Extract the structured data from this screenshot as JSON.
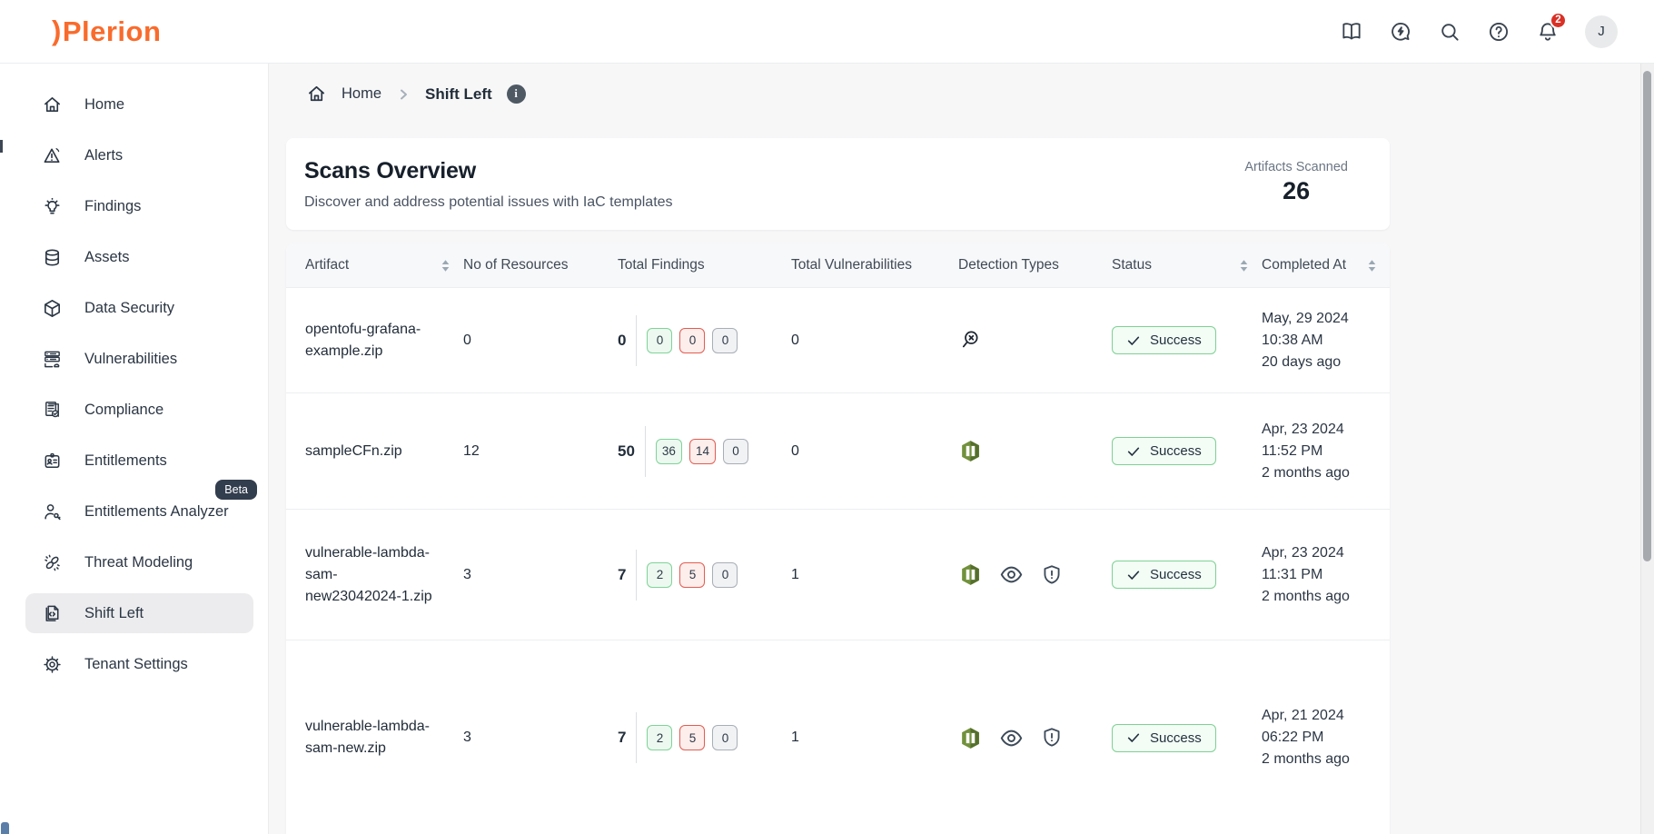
{
  "brand": {
    "logo_mark": ")",
    "logo_text": "Plerion"
  },
  "topbar": {
    "icons": [
      "docs-book-icon",
      "feedback-chat-icon",
      "search-icon",
      "help-icon",
      "notifications-bell-icon"
    ],
    "notification_count": "2",
    "avatar_initial": "J"
  },
  "sidebar": {
    "items": [
      {
        "label": "Home",
        "icon": "home-icon"
      },
      {
        "label": "Alerts",
        "icon": "alerts-icon"
      },
      {
        "label": "Findings",
        "icon": "findings-icon"
      },
      {
        "label": "Assets",
        "icon": "assets-icon"
      },
      {
        "label": "Data Security",
        "icon": "data-security-icon"
      },
      {
        "label": "Vulnerabilities",
        "icon": "vulnerabilities-icon"
      },
      {
        "label": "Compliance",
        "icon": "compliance-icon"
      },
      {
        "label": "Entitlements",
        "icon": "entitlements-icon"
      },
      {
        "label": "Entitlements Analyzer",
        "icon": "entitlements-analyzer-icon",
        "badge": "Beta"
      },
      {
        "label": "Threat Modeling",
        "icon": "threat-modeling-icon"
      },
      {
        "label": "Shift Left",
        "icon": "shift-left-icon",
        "active": true
      },
      {
        "label": "Tenant Settings",
        "icon": "tenant-settings-icon"
      }
    ]
  },
  "breadcrumb": {
    "items": [
      "Home",
      "Shift Left"
    ]
  },
  "overview": {
    "title": "Scans Overview",
    "subtitle": "Discover and address potential issues with IaC templates",
    "stat_label": "Artifacts Scanned",
    "stat_value": "26"
  },
  "table": {
    "columns": [
      {
        "label": "Artifact",
        "sortable": true
      },
      {
        "label": "No of Resources",
        "sortable": false
      },
      {
        "label": "Total Findings",
        "sortable": false
      },
      {
        "label": "Total Vulnerabilities",
        "sortable": false
      },
      {
        "label": "Detection Types",
        "sortable": false
      },
      {
        "label": "Status",
        "sortable": true
      },
      {
        "label": "Completed At",
        "sortable": true
      }
    ],
    "rows": [
      {
        "artifact": "opentofu-grafana-example.zip",
        "resources": "0",
        "findings_total": "0",
        "findings_badges": [
          "0",
          "0",
          "0"
        ],
        "vulnerabilities": "0",
        "detections": [
          "scan-no-detection-icon"
        ],
        "status": "Success",
        "completed_date": "May, 29 2024 10:38 AM",
        "completed_ago": "20 days ago"
      },
      {
        "artifact": "sampleCFn.zip",
        "resources": "12",
        "findings_total": "50",
        "findings_badges": [
          "36",
          "14",
          "0"
        ],
        "vulnerabilities": "0",
        "detections": [
          "cloudformation-icon"
        ],
        "status": "Success",
        "completed_date": "Apr, 23 2024 11:52 PM",
        "completed_ago": "2 months ago"
      },
      {
        "artifact": "vulnerable-lambda-sam-new23042024-1.zip",
        "resources": "3",
        "findings_total": "7",
        "findings_badges": [
          "2",
          "5",
          "0"
        ],
        "vulnerabilities": "1",
        "detections": [
          "cloudformation-icon",
          "eye-icon",
          "shield-icon"
        ],
        "status": "Success",
        "completed_date": "Apr, 23 2024 11:31 PM",
        "completed_ago": "2 months ago"
      },
      {
        "artifact": "vulnerable-lambda-sam-new.zip",
        "resources": "3",
        "findings_total": "7",
        "findings_badges": [
          "2",
          "5",
          "0"
        ],
        "vulnerabilities": "1",
        "detections": [
          "cloudformation-icon",
          "eye-icon",
          "shield-icon"
        ],
        "status": "Success",
        "completed_date": "Apr, 21 2024 06:22 PM",
        "completed_ago": "2 months ago"
      }
    ]
  },
  "colors": {
    "brand_orange": "#F96B2C",
    "notification_red": "#D93025",
    "success_border": "#7ED194",
    "success_bg": "#F3FCF5",
    "badge_green_border": "#7FD398",
    "badge_green_bg": "#EDF9F0",
    "badge_red_border": "#E25C50",
    "badge_red_bg": "#FDEEEC",
    "badge_gray_border": "#A8AEB6",
    "badge_gray_bg": "#F1F2F4",
    "cloudformation_green": "#6F8F3A",
    "text_dark": "#2B3644"
  }
}
